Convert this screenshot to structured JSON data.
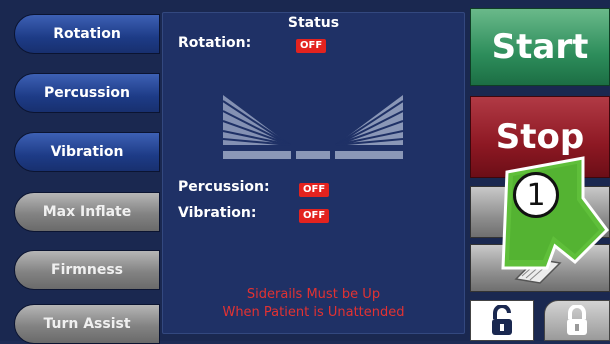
{
  "left_menu": [
    {
      "label": "Rotation",
      "style": "blue"
    },
    {
      "label": "Percussion",
      "style": "blue"
    },
    {
      "label": "Vibration",
      "style": "blue"
    },
    {
      "label": "Max Inflate",
      "style": "gray"
    },
    {
      "label": "Firmness",
      "style": "gray"
    },
    {
      "label": "Turn Assist",
      "style": "gray"
    }
  ],
  "status": {
    "title": "Status",
    "rotation_label": "Rotation:",
    "rotation_value": "OFF",
    "percussion_label": "Percussion:",
    "percussion_value": "OFF",
    "vibration_label": "Vibration:",
    "vibration_value": "OFF",
    "warning_line1": "Siderails Must be Up",
    "warning_line2": "When Patient is Unattended"
  },
  "right_controls": {
    "start_label": "Start",
    "stop_label": "Stop",
    "callout_number": "1"
  },
  "colors": {
    "start": "#2d8d5b",
    "stop": "#8d1823",
    "off_badge": "#e3231f",
    "warning_text": "#e23232",
    "callout_arrow": "#5fbf3a"
  }
}
